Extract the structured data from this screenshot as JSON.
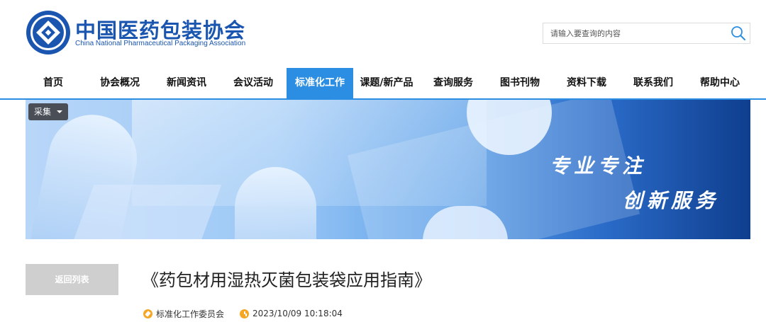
{
  "header": {
    "logo_cn": "中国医药包装协会",
    "logo_en": "China National Pharmaceutical Packaging Association",
    "search": {
      "placeholder": "请输入要查询的内容"
    }
  },
  "nav": {
    "items": [
      {
        "label": "首页"
      },
      {
        "label": "协会概况"
      },
      {
        "label": "新闻资讯"
      },
      {
        "label": "会议活动"
      },
      {
        "label": "标准化工作",
        "active": true
      },
      {
        "label": "课题/新产品"
      },
      {
        "label": "查询服务"
      },
      {
        "label": "图书刊物"
      },
      {
        "label": "资料下载"
      },
      {
        "label": "联系我们"
      },
      {
        "label": "帮助中心"
      }
    ]
  },
  "banner": {
    "collect_label": "采集",
    "slogan_line1": "专业专注",
    "slogan_line2": "创新服务"
  },
  "article": {
    "back_label": "返回列表",
    "title": "《药包材用湿热灭菌包装袋应用指南》",
    "author": "标准化工作委员会",
    "datetime": "2023/10/09 10:18:04"
  },
  "colors": {
    "brand": "#1a56b0",
    "nav_active": "#2b8ee3",
    "meta_icon": "#f5a623",
    "back_button": "#cfcfcf"
  },
  "icons": [
    "logo-emblem-icon",
    "search-icon",
    "caret-down-icon",
    "pen-icon",
    "clock-icon"
  ]
}
